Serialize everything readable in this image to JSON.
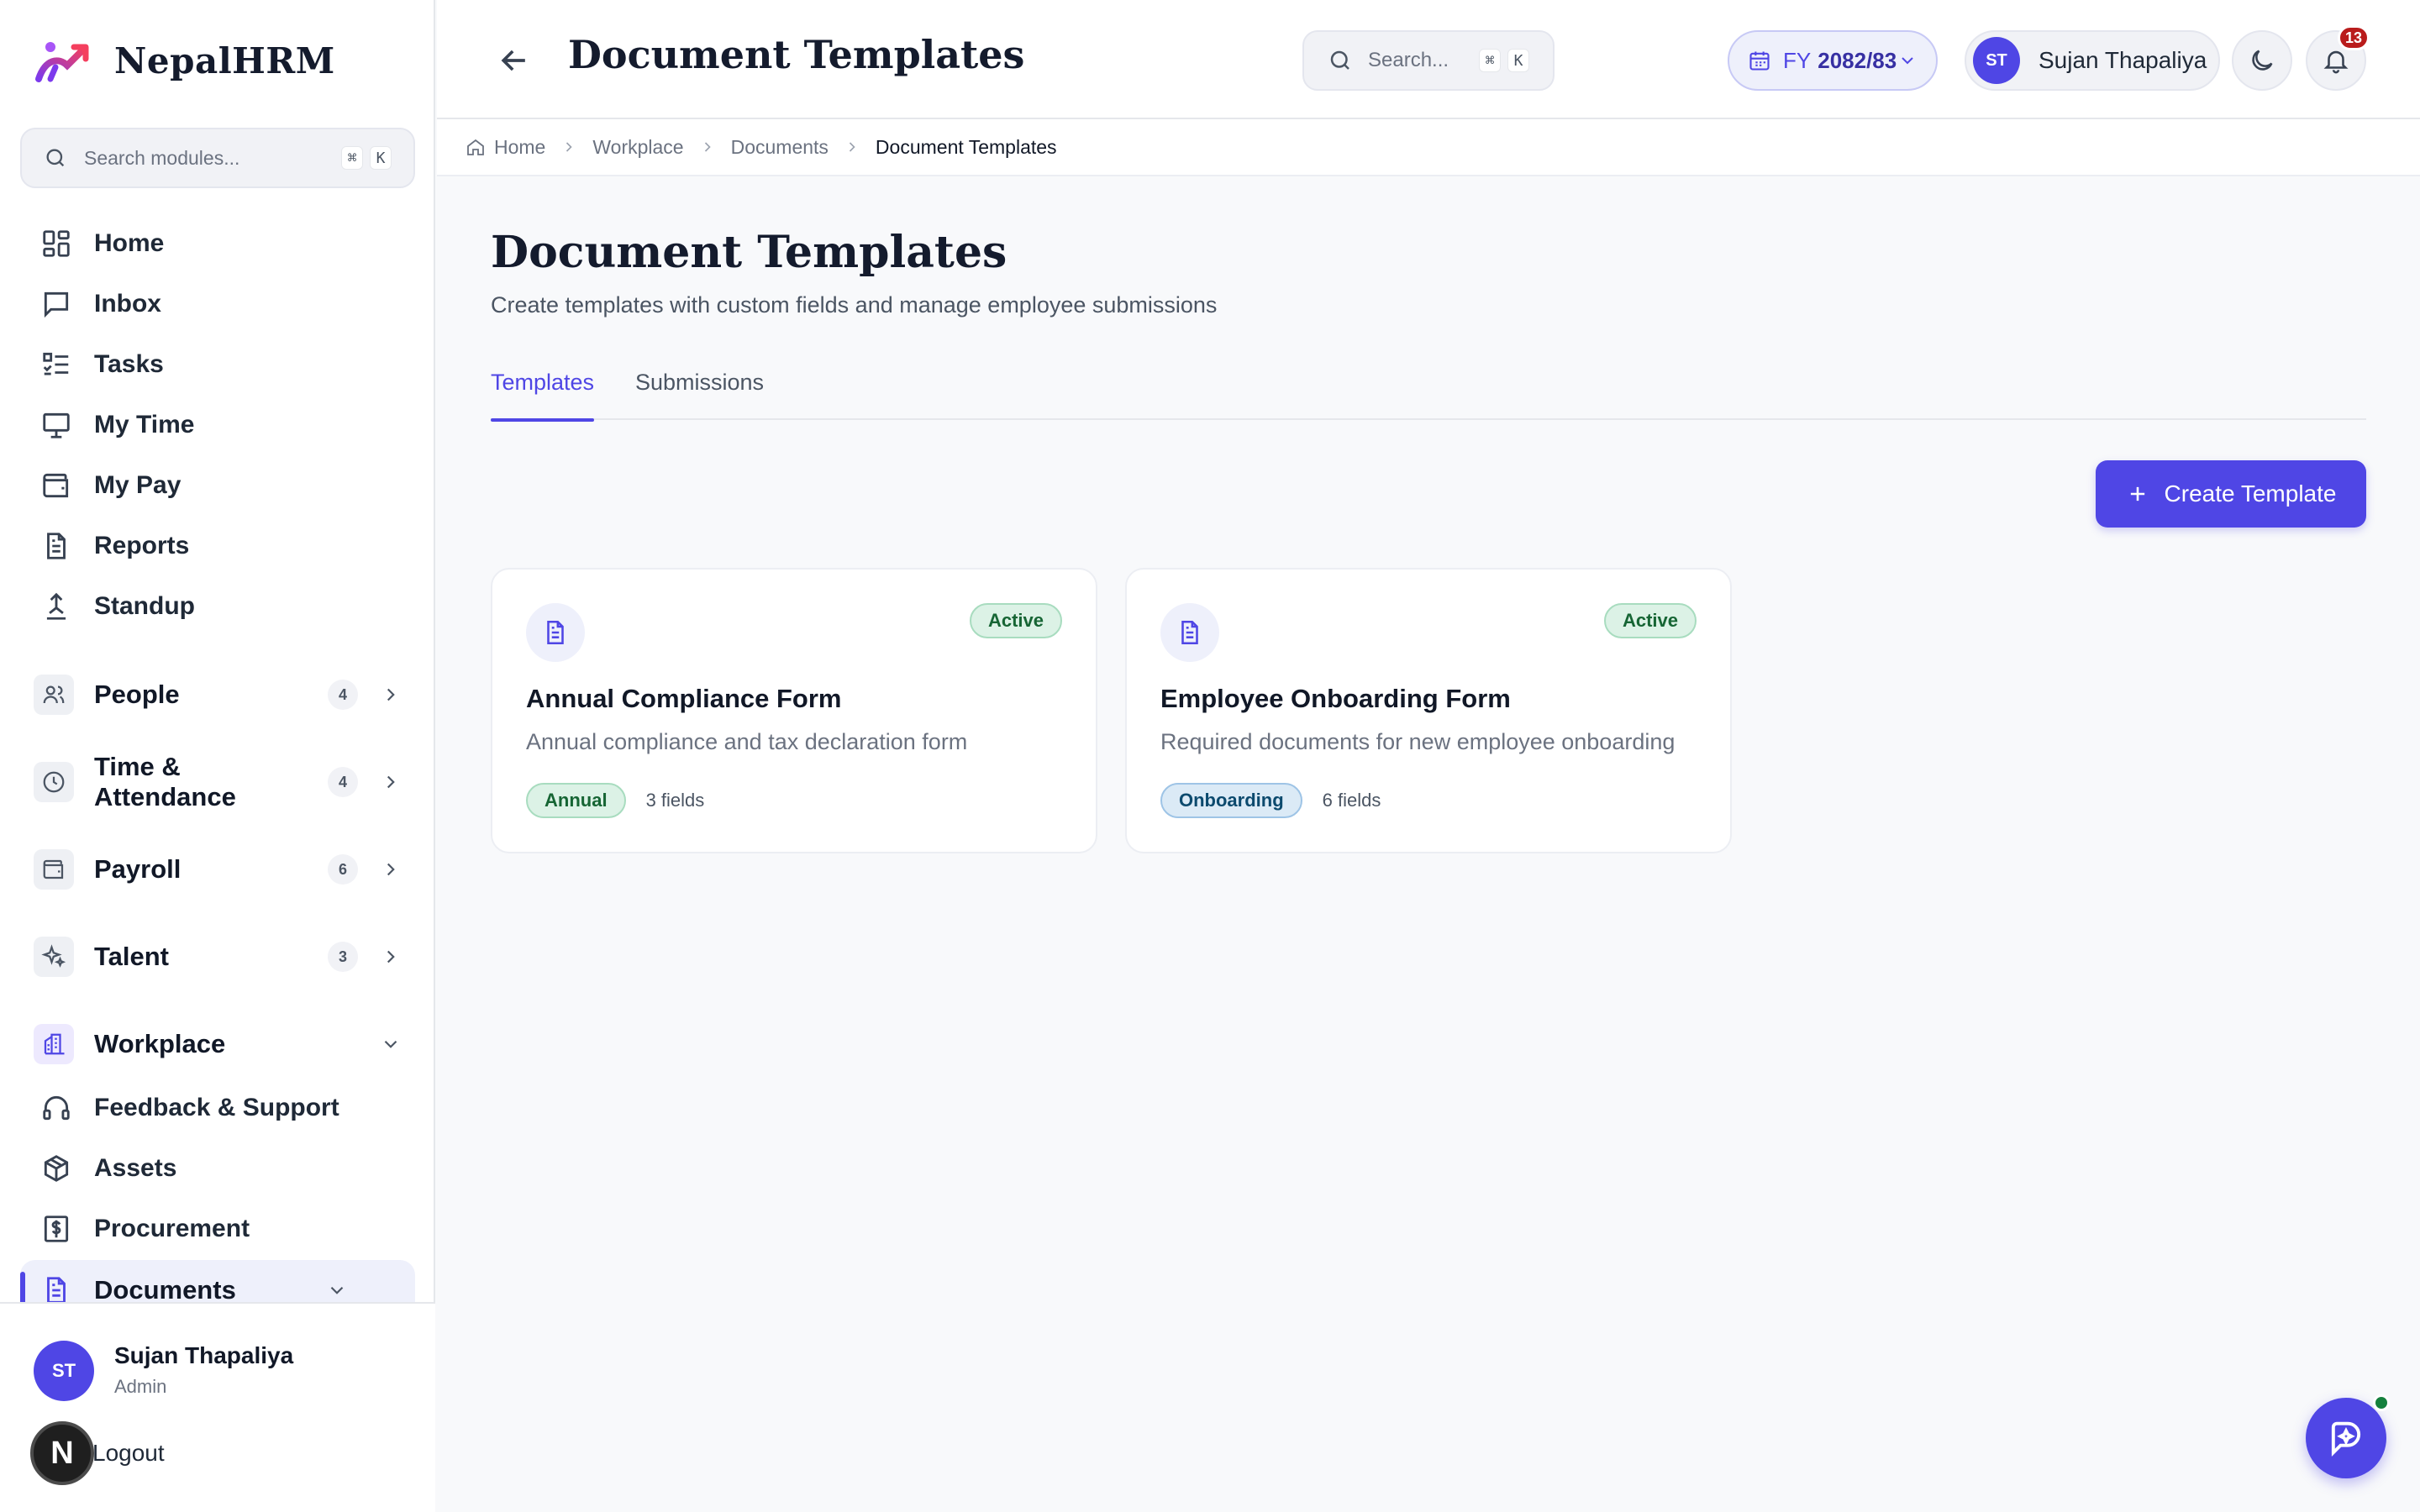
{
  "brand": {
    "name": "NepalHRM"
  },
  "sidebar": {
    "search": {
      "placeholder": "Search modules...",
      "kbd": [
        "⌘",
        "K"
      ]
    },
    "items": [
      {
        "label": "Home",
        "icon": "dashboard-grid-icon"
      },
      {
        "label": "Inbox",
        "icon": "message-square-icon"
      },
      {
        "label": "Tasks",
        "icon": "list-checks-icon"
      },
      {
        "label": "My Time",
        "icon": "monitor-icon"
      },
      {
        "label": "My Pay",
        "icon": "wallet-icon"
      },
      {
        "label": "Reports",
        "icon": "file-text-icon"
      },
      {
        "label": "Standup",
        "icon": "person-standing-icon"
      }
    ],
    "groups": [
      {
        "label": "People",
        "count": "4",
        "icon": "users-icon"
      },
      {
        "label": "Time & Attendance",
        "count": "4",
        "icon": "clock-icon"
      },
      {
        "label": "Payroll",
        "count": "6",
        "icon": "wallet-icon"
      },
      {
        "label": "Talent",
        "count": "3",
        "icon": "sparkles-icon"
      }
    ],
    "workplace": {
      "label": "Workplace",
      "items": [
        {
          "label": "Feedback & Support",
          "icon": "headphones-icon"
        },
        {
          "label": "Assets",
          "icon": "box-icon"
        },
        {
          "label": "Procurement",
          "icon": "receipt-dollar-icon"
        }
      ],
      "active_item": "Documents"
    },
    "footer": {
      "initials": "ST",
      "name": "Sujan Thapaliya",
      "role": "Admin",
      "logout": "Logout",
      "n_badge": "N"
    }
  },
  "topbar": {
    "title": "Document Templates",
    "search": {
      "placeholder": "Search...",
      "kbd": [
        "⌘",
        "K"
      ]
    },
    "fiscal_year": {
      "prefix": "FY",
      "value": "2082/83"
    },
    "user": {
      "initials": "ST",
      "name": "Sujan Thapaliya"
    },
    "notifications_count": "13"
  },
  "breadcrumb": [
    "Home",
    "Workplace",
    "Documents",
    "Document Templates"
  ],
  "main": {
    "title": "Document Templates",
    "subtitle": "Create templates with custom fields and manage employee submissions",
    "tabs": [
      {
        "label": "Templates",
        "active": true
      },
      {
        "label": "Submissions",
        "active": false
      }
    ],
    "create_button": "Create Template",
    "cards": [
      {
        "title": "Annual Compliance Form",
        "description": "Annual compliance and tax declaration form",
        "status": "Active",
        "tag": "Annual",
        "fields": "3 fields"
      },
      {
        "title": "Employee Onboarding Form",
        "description": "Required documents for new employee onboarding",
        "status": "Active",
        "tag": "Onboarding",
        "fields": "6 fields"
      }
    ]
  },
  "colors": {
    "accent": "#4f46e5",
    "active_green": "#166534",
    "tag_blue": "#0c4a6e",
    "notif_red": "#b91c1c"
  }
}
